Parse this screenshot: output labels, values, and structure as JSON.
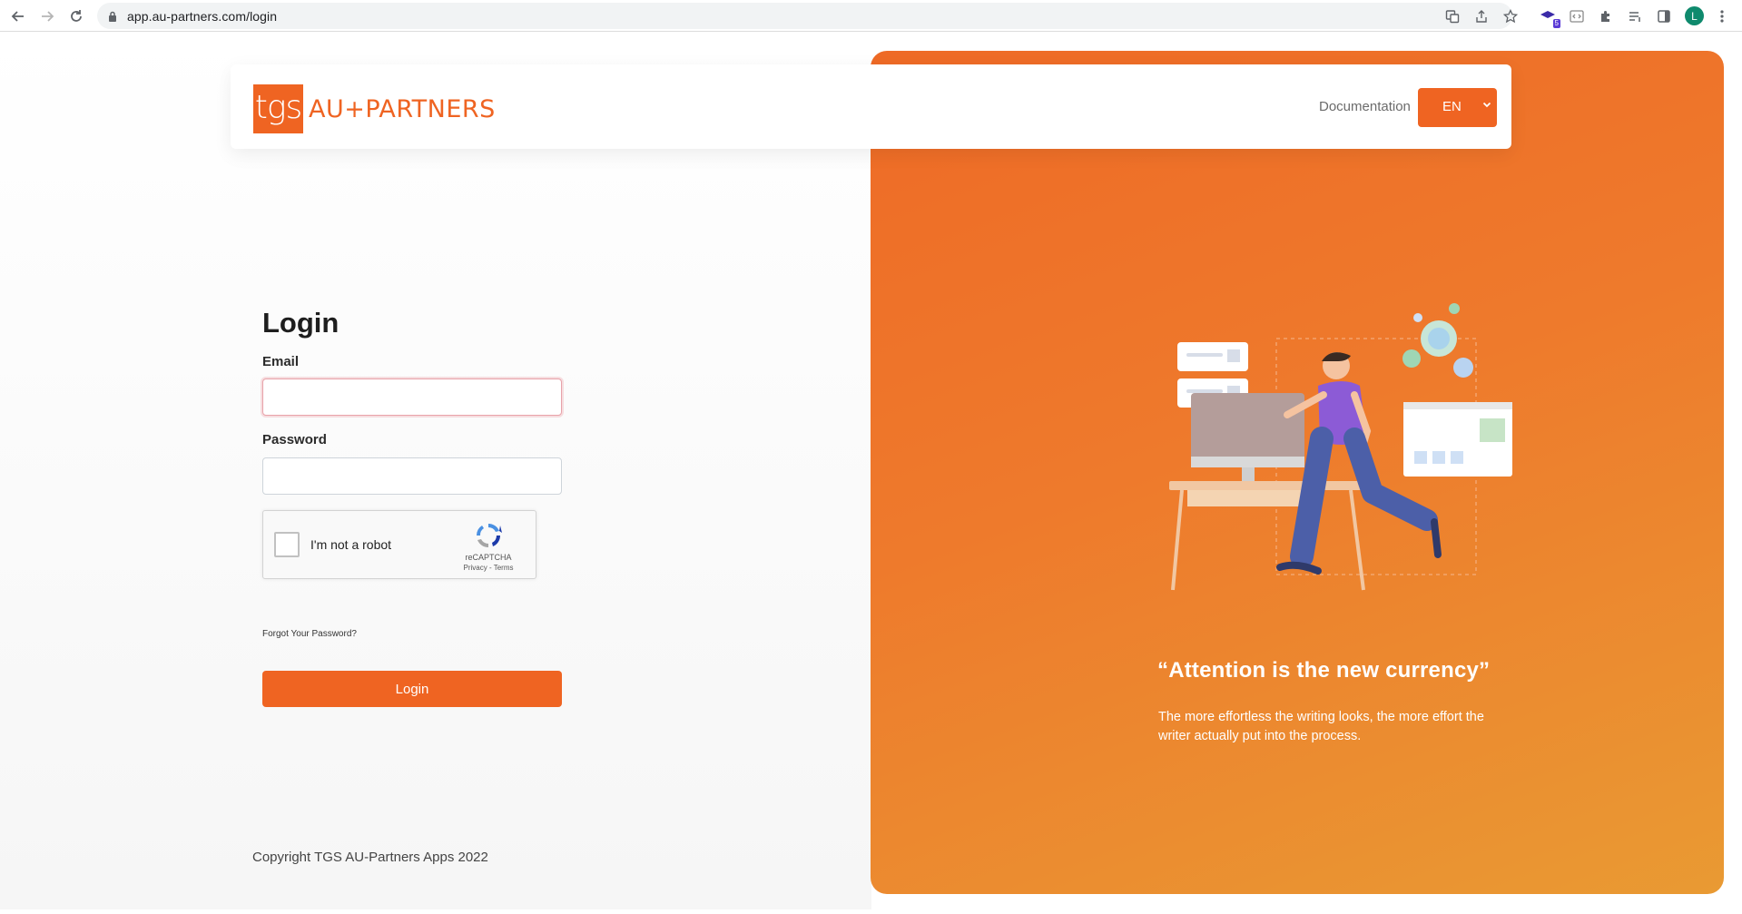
{
  "browser": {
    "url": "app.au-partners.com/login",
    "profile_initial": "L",
    "extension_badge": "5"
  },
  "header": {
    "logo_mark": "tgs",
    "logo_text": "AU+PARTNERS",
    "documentation_link": "Documentation",
    "language": "EN"
  },
  "login": {
    "title": "Login",
    "email_label": "Email",
    "email_value": "",
    "password_label": "Password",
    "password_value": "",
    "captcha_label": "I'm not a robot",
    "captcha_brand": "reCAPTCHA",
    "captcha_links": "Privacy - Terms",
    "forgot_password": "Forgot Your Password?",
    "submit_label": "Login"
  },
  "footer": {
    "copyright": "Copyright TGS AU-Partners Apps 2022"
  },
  "hero": {
    "quote": "“Attention is the new currency”",
    "subtext": "The more effortless the writing looks, the more effort the writer actually put into the process."
  },
  "colors": {
    "brand_orange": "#ef6422",
    "hero_gradient_start": "#ee6a26",
    "hero_gradient_end": "#e99a33"
  }
}
